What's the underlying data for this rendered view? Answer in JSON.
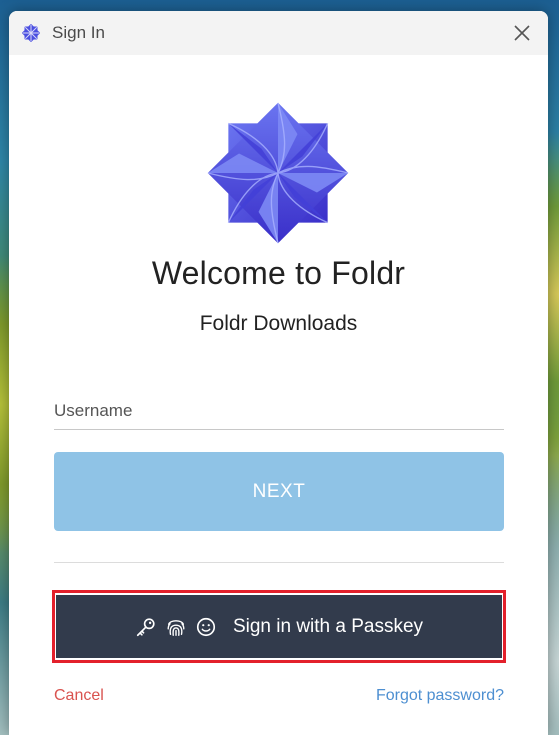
{
  "window": {
    "title": "Sign In",
    "icon": "foldr-logo-icon",
    "close_icon": "close-icon"
  },
  "main": {
    "logo_icon": "foldr-pinwheel-logo",
    "welcome": "Welcome to Foldr",
    "subtitle": "Foldr Downloads"
  },
  "form": {
    "username_placeholder": "Username",
    "username_value": "",
    "next_label": "NEXT",
    "passkey_label": "Sign in with a Passkey",
    "passkey_icons": [
      "key-icon",
      "fingerprint-icon",
      "face-icon"
    ],
    "cancel_label": "Cancel",
    "forgot_label": "Forgot password?"
  },
  "colors": {
    "logo_primary": "#4b4fe0",
    "next_button": "#8fc3e6",
    "passkey_button": "#323b4c",
    "highlight_outline": "#e3202b",
    "cancel": "#d9534f",
    "link": "#4d8fd1"
  }
}
